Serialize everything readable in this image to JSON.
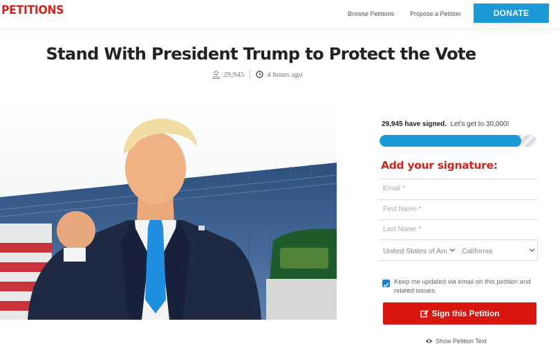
{
  "header": {
    "logo": "PETITIONS",
    "nav": {
      "browse": "Browse Petitions",
      "propose": "Propose a Petition"
    },
    "donate": "DONATE"
  },
  "petition": {
    "title": "Stand With President Trump to Protect the Vote",
    "signers": "29,945",
    "posted": "4 hours ago"
  },
  "signature": {
    "count_text": "29,945 have signed.",
    "goal_text": "Let's get to 30,000!",
    "progress_fraction": 0.9982,
    "heading": "Add your signature:",
    "fields": {
      "email": "Email *",
      "first_name": "First Name *",
      "last_name": "Last Name *"
    },
    "country": "United States of America",
    "state": "California",
    "optin_checked": true,
    "optin_text": "Keep me updated via email on this petition and related issues.",
    "submit": "Sign this Petition",
    "show_text": "Show Petition Text"
  },
  "icons": {
    "user": "user-icon",
    "clock": "clock-icon",
    "edit": "edit-icon",
    "eye": "eye-icon",
    "chevron": "chevron-down-icon"
  },
  "colors": {
    "brand_red": "#d0241c",
    "accent_blue": "#1c9ad6",
    "button_red": "#d9150f"
  }
}
